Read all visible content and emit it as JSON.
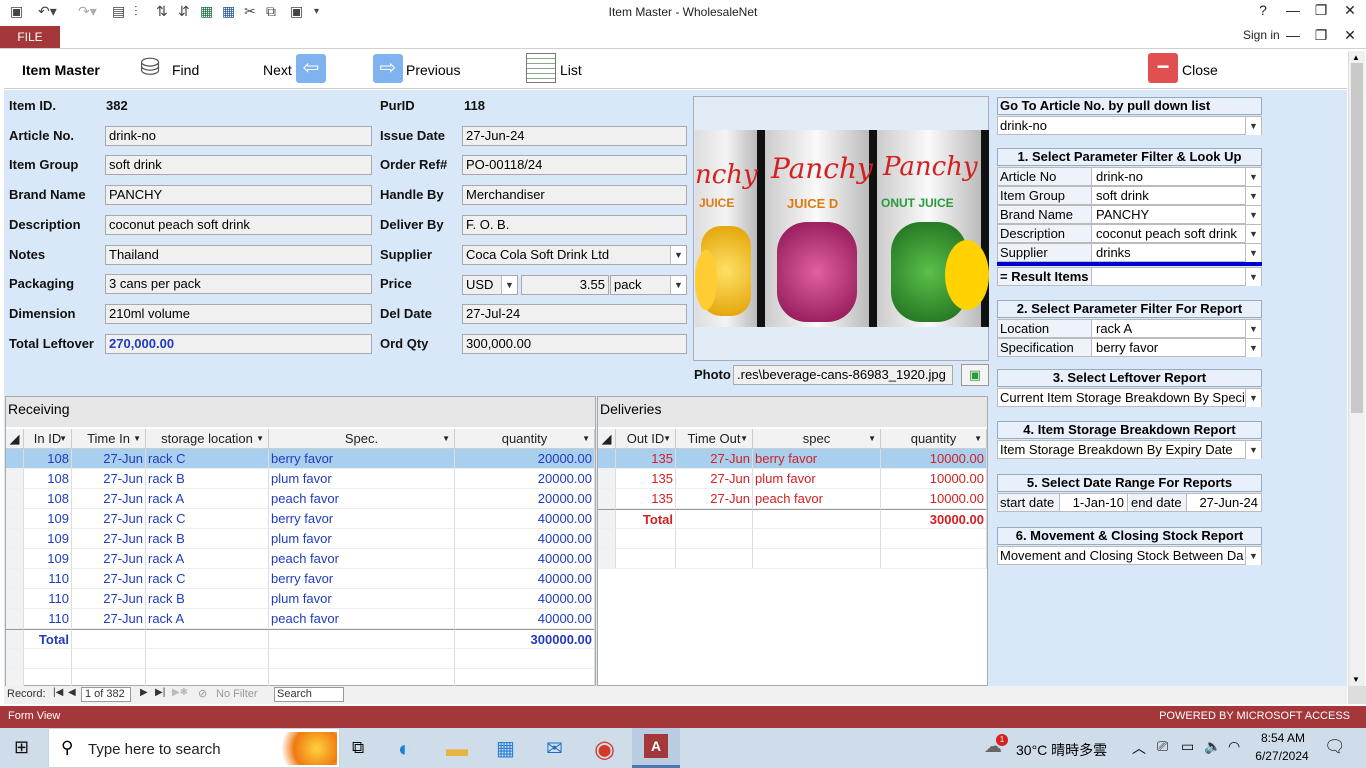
{
  "window": {
    "title": "Item Master - WholesaleNet",
    "help": "?",
    "file_tab": "FILE",
    "sign_in": "Sign in"
  },
  "header": {
    "form_title": "Item Master",
    "find": "Find",
    "next": "Next",
    "previous": "Previous",
    "list": "List",
    "close": "Close"
  },
  "form": {
    "item_id_label": "Item ID.",
    "item_id": "382",
    "purid_label": "PurID",
    "purid": "118",
    "article_no_label": "Article No.",
    "article_no": "drink-no",
    "issue_date_label": "Issue Date",
    "issue_date": "27-Jun-24",
    "item_group_label": "Item Group",
    "item_group": "soft drink",
    "order_ref_label": "Order Ref#",
    "order_ref": "PO-00118/24",
    "brand_label": "Brand Name",
    "brand": "PANCHY",
    "handle_label": "Handle By",
    "handle": "Merchandiser",
    "description_label": "Description",
    "description": "coconut peach soft drink",
    "deliver_label": "Deliver By",
    "deliver": "F. O. B.",
    "notes_label": "Notes",
    "notes": "Thailand",
    "supplier_label": "Supplier",
    "supplier": "Coca Cola Soft Drink Ltd",
    "packaging_label": "Packaging",
    "packaging": "3 cans per pack",
    "price_label": "Price",
    "currency": "USD",
    "price": "3.55",
    "unit": "pack",
    "dimension_label": "Dimension",
    "dimension": "210ml volume",
    "del_date_label": "Del Date",
    "del_date": "27-Jul-24",
    "leftover_label": "Total Leftover",
    "leftover": "270,000.00",
    "ord_qty_label": "Ord Qty",
    "ord_qty": "300,000.00",
    "photo_label": "Photo",
    "photo_path": ".res\\beverage-cans-86983_1920.jpg"
  },
  "photo": {
    "can1": "nchy",
    "can2": "Panchy",
    "can3": "Panchy",
    "can1b": "JUICE",
    "can2b": "JUICE D",
    "can3b": "ONUT JUICE"
  },
  "right_panel": {
    "goto_title": "Go To Article No. by pull down list",
    "goto_value": "drink-no",
    "s1_title": "1. Select Parameter Filter & Look Up",
    "s1_rows": [
      {
        "label": "Article No",
        "value": "drink-no"
      },
      {
        "label": "Item Group",
        "value": "soft drink"
      },
      {
        "label": "Brand Name",
        "value": "PANCHY"
      },
      {
        "label": "Description",
        "value": "coconut peach soft drink"
      },
      {
        "label": "Supplier",
        "value": "drinks"
      }
    ],
    "result_label": "= Result Items",
    "result_value": "",
    "s2_title": "2. Select Parameter Filter For Report",
    "s2_rows": [
      {
        "label": "Location",
        "value": "rack A"
      },
      {
        "label": "Specification",
        "value": "berry favor"
      }
    ],
    "s3_title": "3. Select Leftover Report",
    "s3_value": "Current Item Storage Breakdown By Specification",
    "s4_title": "4. Item Storage Breakdown Report",
    "s4_value": "Item Storage Breakdown By Expiry Date",
    "s5_title": "5. Select Date Range For  Reports",
    "start_label": "start date",
    "start_value": "1-Jan-10",
    "end_label": "end date",
    "end_value": "27-Jun-24",
    "s6_title": "6. Movement & Closing Stock Report",
    "s6_value": "Movement and Closing Stock Between Dates"
  },
  "receiving": {
    "title": "Receiving",
    "headers": [
      "In ID",
      "Time In",
      "storage location",
      "Spec.",
      "quantity"
    ],
    "rows": [
      [
        "108",
        "27-Jun",
        "rack C",
        "berry favor",
        "20000.00"
      ],
      [
        "108",
        "27-Jun",
        "rack B",
        "plum favor",
        "20000.00"
      ],
      [
        "108",
        "27-Jun",
        "rack A",
        "peach favor",
        "20000.00"
      ],
      [
        "109",
        "27-Jun",
        "rack C",
        "berry favor",
        "40000.00"
      ],
      [
        "109",
        "27-Jun",
        "rack B",
        "plum favor",
        "40000.00"
      ],
      [
        "109",
        "27-Jun",
        "rack A",
        "peach favor",
        "40000.00"
      ],
      [
        "110",
        "27-Jun",
        "rack C",
        "berry favor",
        "40000.00"
      ],
      [
        "110",
        "27-Jun",
        "rack B",
        "plum favor",
        "40000.00"
      ],
      [
        "110",
        "27-Jun",
        "rack A",
        "peach favor",
        "40000.00"
      ]
    ],
    "total_label": "Total",
    "total": "300000.00"
  },
  "deliveries": {
    "title": "Deliveries",
    "headers": [
      "Out ID",
      "Time Out",
      "spec",
      "quantity"
    ],
    "rows": [
      [
        "135",
        "27-Jun",
        "berry favor",
        "10000.00"
      ],
      [
        "135",
        "27-Jun",
        "plum favor",
        "10000.00"
      ],
      [
        "135",
        "27-Jun",
        "peach favor",
        "10000.00"
      ]
    ],
    "total_label": "Total",
    "total": "30000.00"
  },
  "navbar": {
    "record_label": "Record:",
    "position": "1 of 382",
    "no_filter": "No Filter",
    "search": "Search"
  },
  "status": {
    "view": "Form View",
    "powered": "POWERED BY MICROSOFT ACCESS"
  },
  "taskbar": {
    "search": "Type here to search",
    "weather": "30°C  晴時多雲",
    "time": "8:54 AM",
    "date": "6/27/2024",
    "weather_badge": "1"
  },
  "colors": {
    "access_red": "#a4373a",
    "detail_bg": "#d8e8f8",
    "receiving_text": "#1f3bc1",
    "deliveries_text": "#d42020",
    "selected_row": "#a9cfee"
  }
}
